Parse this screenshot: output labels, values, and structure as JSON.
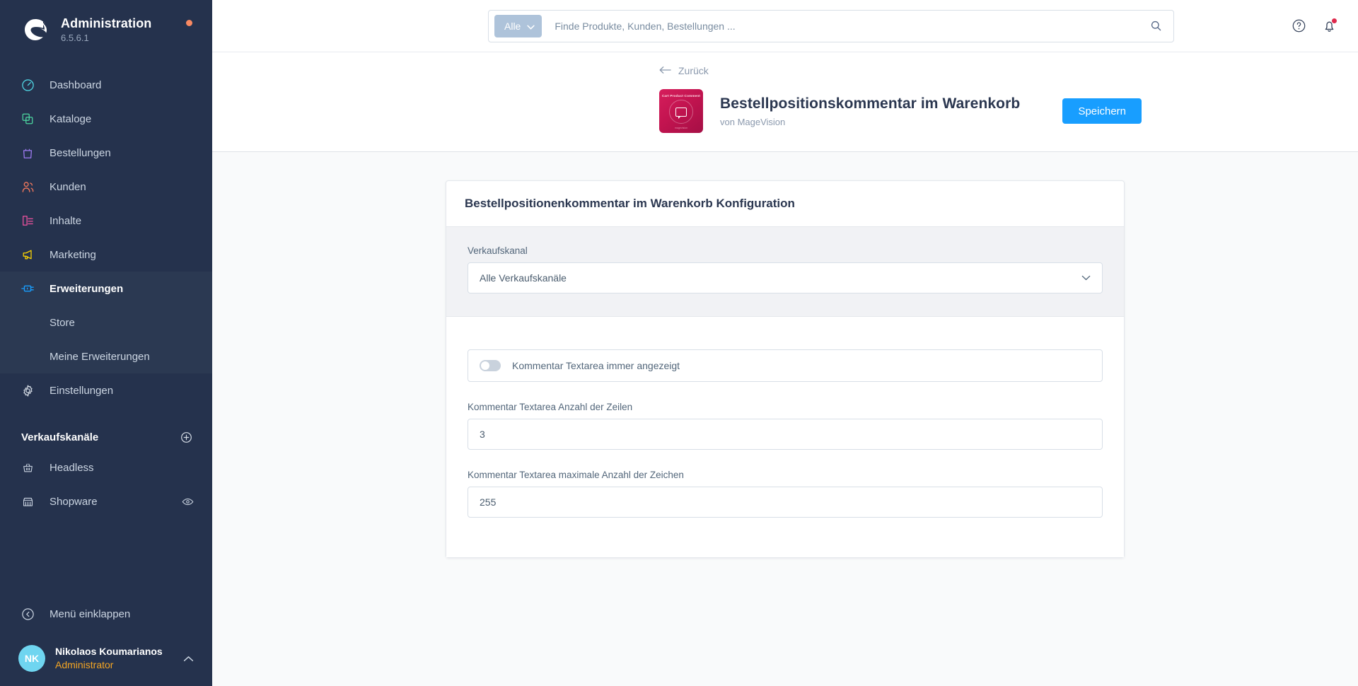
{
  "sidebar": {
    "brand": {
      "title": "Administration",
      "version": "6.5.6.1",
      "logo_icon": "shopware-logo-icon",
      "update_dot_color": "#f88962"
    },
    "nav_items": [
      {
        "label": "Dashboard",
        "icon": "dashboard-gauge-icon",
        "color": "#4fd2e0"
      },
      {
        "label": "Kataloge",
        "icon": "catalog-copy-icon",
        "color": "#4cd7a0"
      },
      {
        "label": "Bestellungen",
        "icon": "orders-bag-icon",
        "color": "#a07cf5"
      },
      {
        "label": "Kunden",
        "icon": "customers-users-icon",
        "color": "#f4795c"
      },
      {
        "label": "Inhalte",
        "icon": "content-document-icon",
        "color": "#f053a0"
      },
      {
        "label": "Marketing",
        "icon": "marketing-megaphone-icon",
        "color": "#ffd600"
      },
      {
        "label": "Erweiterungen",
        "icon": "extensions-plugin-icon",
        "color": "#189eff"
      }
    ],
    "sub_items": [
      {
        "label": "Store"
      },
      {
        "label": "Meine Erweiterungen"
      }
    ],
    "settings_item": {
      "label": "Einstellungen",
      "icon": "gear-icon",
      "color": "#d6dde6"
    },
    "sales_channels": {
      "title": "Verkaufskanäle",
      "add_icon": "plus-circle-icon",
      "items": [
        {
          "label": "Headless",
          "icon": "basket-icon",
          "has_eye": false
        },
        {
          "label": "Shopware",
          "icon": "storefront-icon",
          "has_eye": true,
          "eye_icon": "eye-icon"
        }
      ]
    },
    "collapse": {
      "label": "Menü einklappen",
      "icon": "chevron-left-circle-icon"
    },
    "user": {
      "initials": "NK",
      "name": "Nikolaos Koumarianos",
      "role": "Administrator",
      "caret_icon": "chevron-up-icon",
      "role_color": "#f5a623"
    }
  },
  "topbar": {
    "search": {
      "scope_label": "Alle",
      "scope_caret_icon": "chevron-down-icon",
      "placeholder": "Finde Produkte, Kunden, Bestellungen ...",
      "value": "",
      "search_icon": "search-icon"
    },
    "help_icon": "help-circle-icon",
    "notifications_icon": "bell-icon",
    "notification_dot_color": "#de294c"
  },
  "page_header": {
    "back_label": "Zurück",
    "back_icon": "arrow-left-icon",
    "plugin_icon": {
      "top_text": "Cart Product Comment",
      "bottom_text": "magevision",
      "glyph_icon": "comment-bubble-icon",
      "color": "#c31450"
    },
    "title": "Bestellpositionskommentar im Warenkorb",
    "subtitle": "von MageVision",
    "save_label": "Speichern",
    "save_color": "#189eff"
  },
  "config_card": {
    "title": "Bestellpositionenkommentar im Warenkorb Konfiguration",
    "sales_channel_field": {
      "label": "Verkaufskanal",
      "value": "Alle Verkaufskanäle",
      "chevron_icon": "chevron-down-icon"
    },
    "toggle_field": {
      "label": "Kommentar Textarea immer angezeigt",
      "checked": false
    },
    "fields": [
      {
        "label": "Kommentar Textarea Anzahl der Zeilen",
        "value": "3"
      },
      {
        "label": "Kommentar Textarea maximale Anzahl der Zeichen",
        "value": "255"
      }
    ]
  }
}
